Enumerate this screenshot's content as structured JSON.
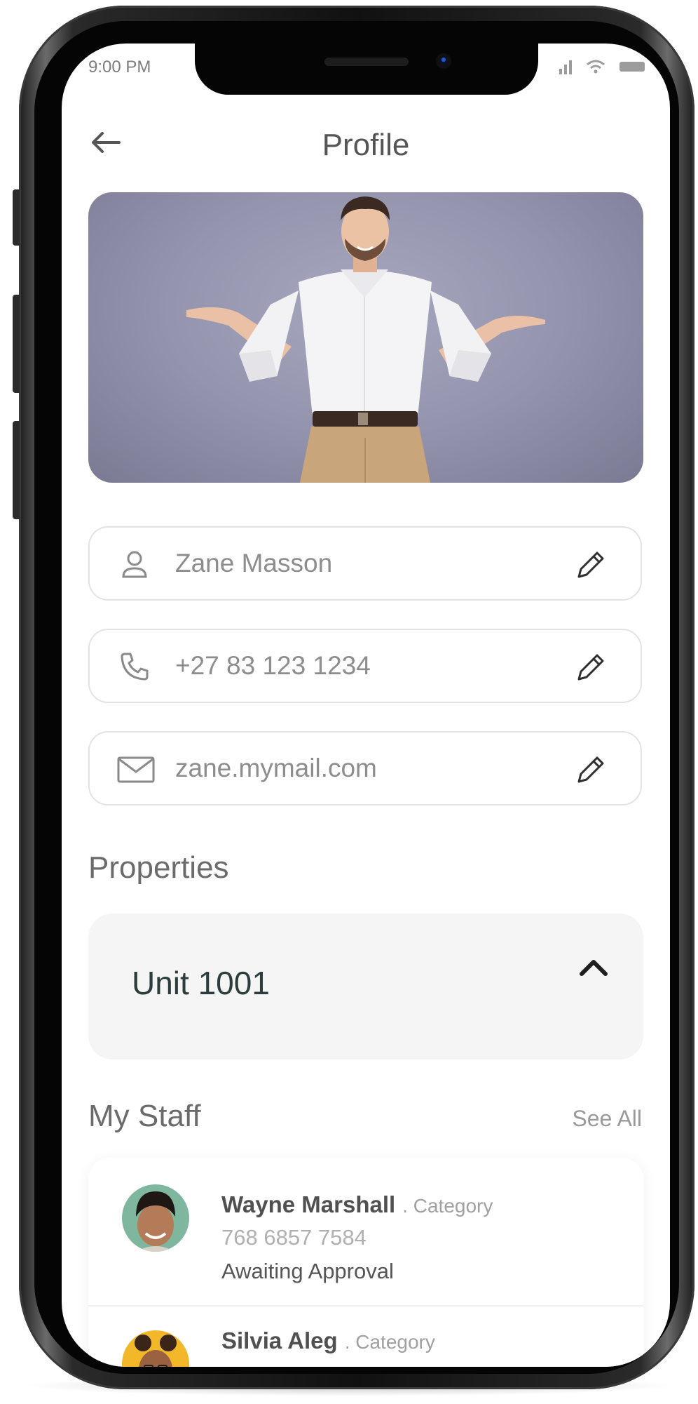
{
  "status_bar": {
    "time": "9:00 PM",
    "signal_icon": "signal-bars-icon",
    "wifi_icon": "wifi-icon",
    "battery_icon": "battery-icon"
  },
  "header": {
    "title": "Profile",
    "back_icon": "arrow-left-icon"
  },
  "profile": {
    "photo": "person-photo",
    "fields": [
      {
        "icon": "user-icon",
        "value": "Zane Masson",
        "edit_icon": "pencil-icon"
      },
      {
        "icon": "phone-icon",
        "value": "+27 83 123 1234",
        "edit_icon": "pencil-icon"
      },
      {
        "icon": "mail-icon",
        "value": "zane.mymail.com",
        "edit_icon": "pencil-icon"
      }
    ]
  },
  "properties": {
    "title": "Properties",
    "unit": "Unit 1001",
    "chevron_icon": "chevron-up-icon"
  },
  "staff": {
    "title": "My Staff",
    "see_all": "See All",
    "members": [
      {
        "name": "Wayne Marshall",
        "category": ". Category",
        "phone": "768 6857 7584",
        "status": "Awaiting Approval"
      },
      {
        "name": "Silvia Aleg",
        "category": ". Category"
      }
    ]
  },
  "colors": {
    "text_primary": "#555555",
    "text_muted": "#8d8d8d",
    "card_bg": "#f5f5f5",
    "border": "#e3e3e3",
    "unit_text": "#2d3d3d"
  }
}
